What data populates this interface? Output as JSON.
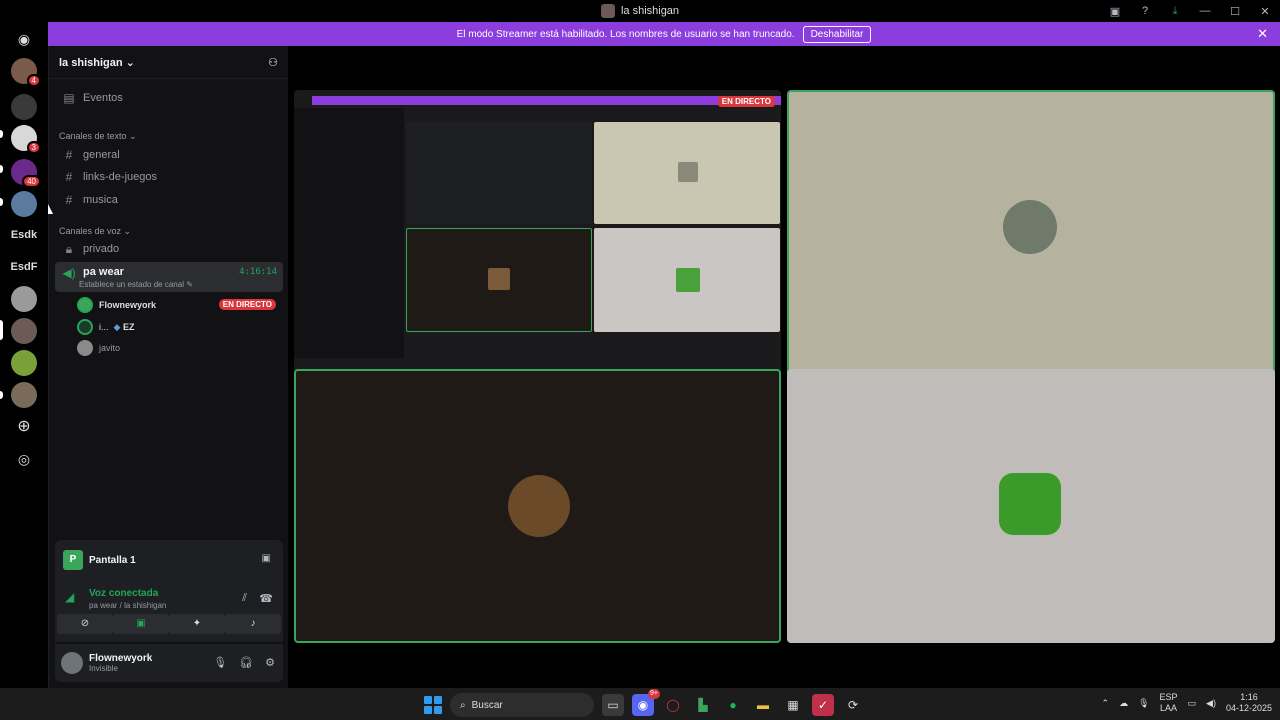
{
  "window": {
    "title": "la shishigan"
  },
  "banner": {
    "text": "El modo Streamer está habilitado. Los nombres de usuario se han truncado.",
    "button": "Deshabilitar"
  },
  "servers": {
    "badges": [
      "4",
      "3",
      "40"
    ],
    "text_servers": [
      "Esdk",
      "EsdF"
    ]
  },
  "guild": {
    "name": "la shishigan",
    "events_label": "Eventos",
    "text_category": "Canales de texto",
    "text_channels": [
      "general",
      "links-de-juegos",
      "musica"
    ],
    "voice_category": "Canales de voz",
    "voice_channels": [
      "privado",
      "pa wear"
    ],
    "active_timer": "4:16:14",
    "channel_status": "Establece un estado de canal",
    "voice_users": [
      {
        "name": "Flownewyork",
        "live": "EN DIRECTO"
      },
      {
        "name": "i...",
        "tag": "EZ"
      },
      {
        "name": "javito"
      }
    ]
  },
  "stream_panel": {
    "label": "Pantalla 1"
  },
  "voice_panel": {
    "status": "Voz conectada",
    "location": "pa wear / la shishigan"
  },
  "user_panel": {
    "name": "Flownewyork",
    "status": "Invisible"
  },
  "stage": {
    "live_label": "EN DIRECTO"
  },
  "taskbar": {
    "search_placeholder": "Buscar",
    "lang_top": "ESP",
    "lang_bottom": "LAA",
    "time": "1:16",
    "date": "04-12-2025",
    "discord_badge": "9+"
  },
  "colors": {
    "accent": "#8b3dde",
    "live": "#da373c",
    "connected": "#23a55a",
    "speaking_border": "#3ba55c"
  }
}
